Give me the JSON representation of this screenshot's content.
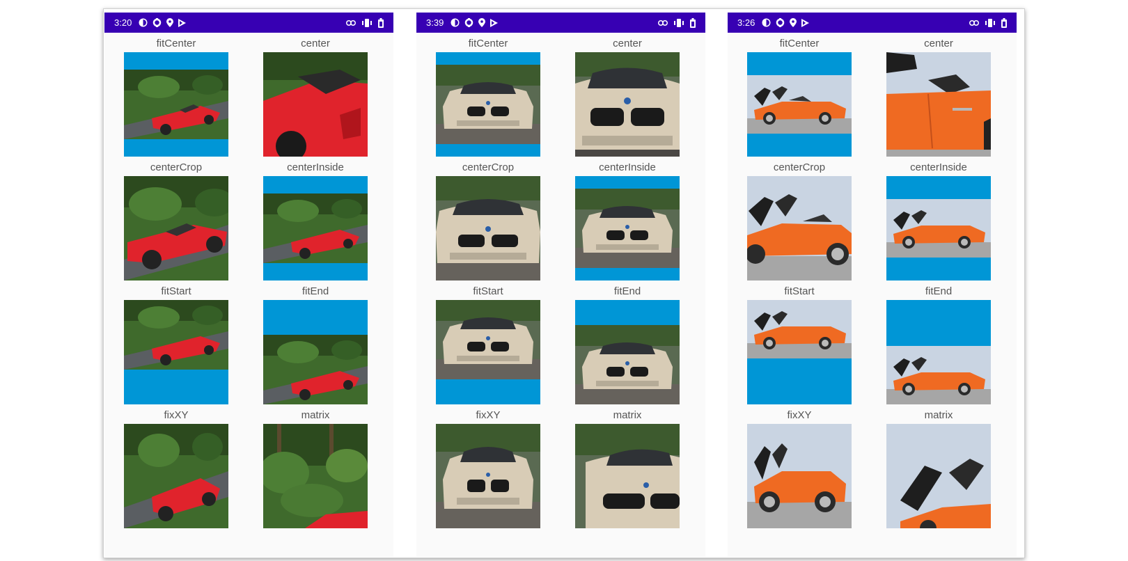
{
  "colors": {
    "statusbar": "#3700b3",
    "background_fill": "#0096d6",
    "car_red": "#e0232c",
    "car_silver": "#d8ccb6",
    "car_orange": "#ef6a22"
  },
  "screens": [
    {
      "time": "3:20",
      "status_icons": [
        "settings-circle-icon",
        "sync-icon",
        "location-pin-icon",
        "play-store-icon"
      ],
      "right_icons": [
        "link-icon",
        "vibrate-icon",
        "battery-icon"
      ],
      "photo": "red-convertible-garden",
      "labels": [
        "fitCenter",
        "center",
        "centerCrop",
        "centerInside",
        "fitStart",
        "fitEnd",
        "fixXY",
        "matrix"
      ]
    },
    {
      "time": "3:39",
      "status_icons": [
        "settings-circle-icon",
        "sync-icon",
        "location-pin-icon",
        "play-store-icon"
      ],
      "right_icons": [
        "link-icon",
        "vibrate-icon",
        "battery-icon"
      ],
      "photo": "silver-bmw-front",
      "labels": [
        "fitCenter",
        "center",
        "centerCrop",
        "centerInside",
        "fitStart",
        "fitEnd",
        "fixXY",
        "matrix"
      ]
    },
    {
      "time": "3:26",
      "status_icons": [
        "settings-circle-icon",
        "sync-icon",
        "location-pin-icon",
        "play-store-icon"
      ],
      "right_icons": [
        "link-icon",
        "vibrate-icon",
        "battery-icon"
      ],
      "photo": "orange-roadster-sky",
      "labels": [
        "fitCenter",
        "center",
        "centerCrop",
        "centerInside",
        "fitStart",
        "fitEnd",
        "fixXY",
        "matrix"
      ]
    }
  ]
}
